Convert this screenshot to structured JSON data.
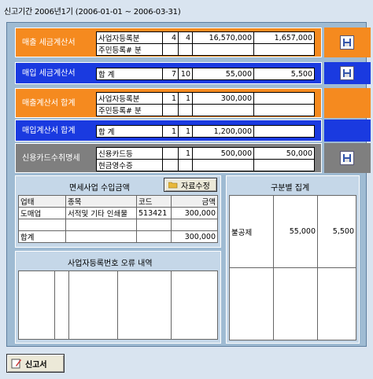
{
  "period": "신고기간 2006년1기  (2006-01-01 ~ 2006-03-31)",
  "rows": [
    {
      "label": "매출 세금계산서",
      "cells": [
        [
          "사업자등록분",
          "4",
          "4",
          "16,570,000",
          "1,657,000"
        ],
        [
          "주민등록# 분",
          "",
          "",
          "",
          ""
        ]
      ]
    },
    {
      "label": "매입 세금계산서",
      "cells": [
        [
          "합  계",
          "7",
          "10",
          "55,000",
          "5,500"
        ]
      ]
    },
    {
      "label": "매출계산서 합계",
      "cells": [
        [
          "사업자등록분",
          "1",
          "1",
          "300,000",
          ""
        ],
        [
          "주민등록# 분",
          "",
          "",
          "",
          ""
        ]
      ]
    },
    {
      "label": "매입계산서 합계",
      "cells": [
        [
          "합  계",
          "1",
          "1",
          "1,200,000",
          ""
        ]
      ]
    },
    {
      "label": "신용카드수취명세",
      "cells": [
        [
          "신용카드등",
          "",
          "1",
          "500,000",
          "50,000"
        ],
        [
          "현금영수증",
          "",
          "",
          "",
          ""
        ]
      ]
    }
  ],
  "exempt": {
    "title": "면세사업 수입금액",
    "edit_label": "자료수정",
    "headers": [
      "업태",
      "종목",
      "코드",
      "금액"
    ],
    "rows": [
      [
        "도매업",
        "서적및 기타 인쇄물",
        "513421",
        "300,000"
      ],
      [
        "",
        "",
        "",
        ""
      ]
    ],
    "total_label": "합계",
    "total_value": "300,000"
  },
  "error_title": "사업자등록번호 오류 내역",
  "category": {
    "title": "구분별 집계",
    "row": [
      "불공제",
      "55,000",
      "5,500"
    ]
  },
  "report_label": "신고서"
}
